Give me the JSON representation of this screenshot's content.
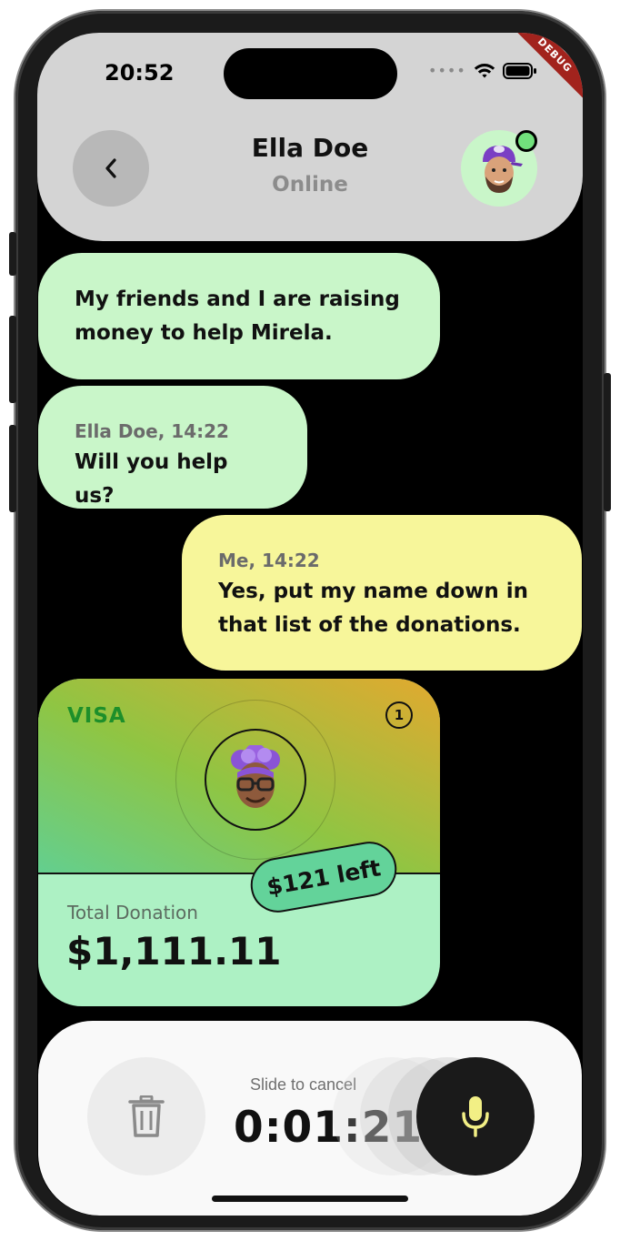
{
  "status_bar": {
    "time": "20:52",
    "signal_icon": "signal-dots-icon",
    "wifi_icon": "wifi-icon",
    "battery_icon": "battery-icon",
    "debug_banner": "DEBUG"
  },
  "header": {
    "back_icon": "chevron-left-icon",
    "contact_name": "Ella Doe",
    "contact_status": "Online",
    "status_color": "#71e07c"
  },
  "messages": [
    {
      "sender": "them",
      "meta": "",
      "text_lines": [
        "My friends and I are raising",
        "money to help Mirela."
      ]
    },
    {
      "sender": "them",
      "meta": "Ella Doe, 14:22",
      "text_lines": [
        "Will you help us?"
      ]
    },
    {
      "sender": "me",
      "meta": "Me, 14:22",
      "text_lines": [
        "Yes, put my name down in",
        "that list of the donations."
      ]
    }
  ],
  "donation_card": {
    "brand": "VISA",
    "badge_count": "1",
    "remaining": "$121 left",
    "total_label": "Total Donation",
    "total_value": "$1,111.11"
  },
  "recorder": {
    "slide_hint": "Slide to cancel",
    "timer": "0:01:21",
    "trash_icon": "trash-icon",
    "mic_icon": "microphone-icon",
    "mic_color": "#f2ef85"
  },
  "colors": {
    "bubble_incoming": "#c9f6c9",
    "bubble_outgoing": "#f7f69a",
    "header_bg": "#d4d4d4"
  }
}
